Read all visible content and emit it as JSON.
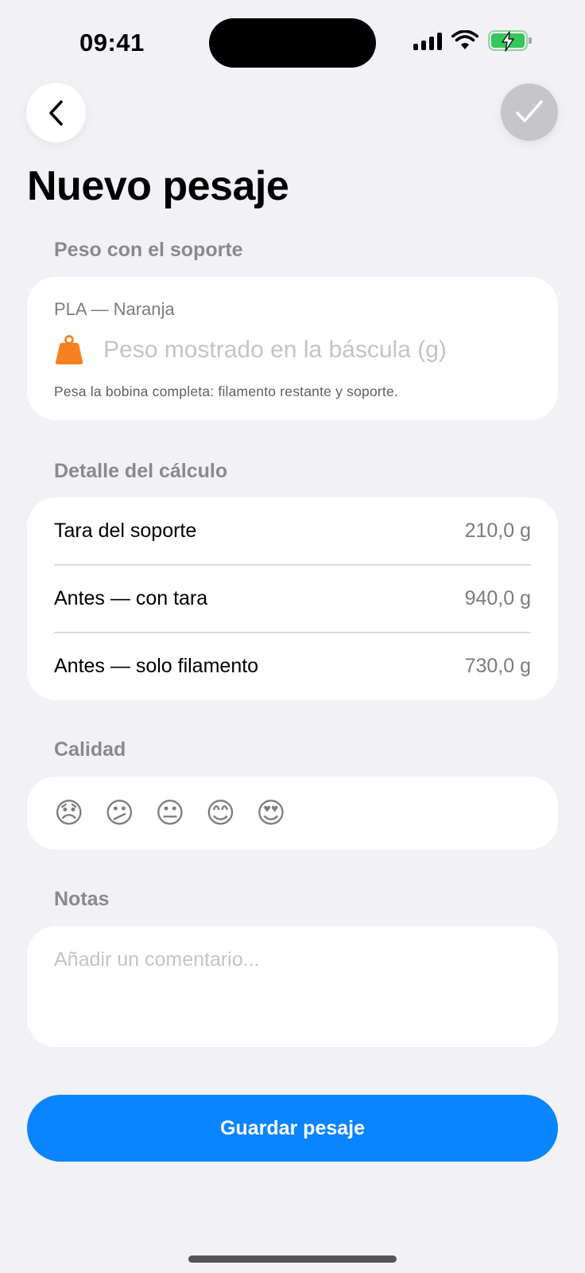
{
  "status_bar": {
    "time": "09:41"
  },
  "nav": {
    "back_icon": "chevron-left-icon",
    "done_icon": "checkmark-icon"
  },
  "page": {
    "title": "Nuevo pesaje"
  },
  "weight_section": {
    "label": "Peso con el soporte",
    "spool_name": "PLA — Naranja",
    "input_placeholder": "Peso mostrado en la báscula (g)",
    "input_value": "",
    "hint": "Pesa la bobina completa: filamento restante y soporte.",
    "icon": "scale-weight-icon",
    "icon_color": "#f5821f"
  },
  "detail_section": {
    "label": "Detalle del cálculo",
    "rows": [
      {
        "label": "Tara del soporte",
        "value": "210,0 g"
      },
      {
        "label": "Antes — con tara",
        "value": "940,0 g"
      },
      {
        "label": "Antes — solo filamento",
        "value": "730,0 g"
      }
    ]
  },
  "quality_section": {
    "label": "Calidad",
    "options": [
      "😞",
      "😕",
      "😐",
      "😊",
      "😍"
    ]
  },
  "notes_section": {
    "label": "Notas",
    "placeholder": "Añadir un comentario...",
    "value": ""
  },
  "save_button": {
    "label": "Guardar pesaje",
    "color": "#0a84ff"
  }
}
